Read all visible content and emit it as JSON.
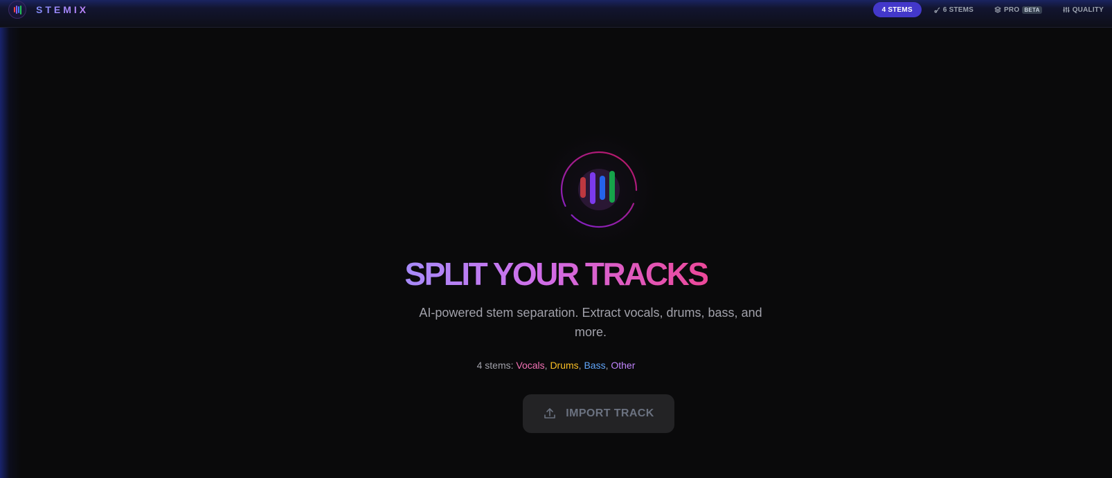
{
  "app": {
    "name": "STEMIX"
  },
  "nav": {
    "items": [
      {
        "label": "4 STEMS",
        "icon": "none",
        "active": true
      },
      {
        "label": "6 STEMS",
        "icon": "guitar-icon",
        "active": false
      },
      {
        "label": "PRO",
        "icon": "layers-icon",
        "badge": "BETA",
        "active": false
      },
      {
        "label": "QUALITY",
        "icon": "sliders-icon",
        "active": false
      }
    ]
  },
  "hero": {
    "icon": "waveform-icon",
    "title": "SPLIT YOUR TRACKS",
    "subtitle": "AI-powered stem separation. Extract vocals, drums, bass, and more.",
    "stems_prefix": "4 stems: ",
    "stems": [
      {
        "name": "Vocals",
        "color": "#f472b6"
      },
      {
        "name": "Drums",
        "color": "#fbbf24"
      },
      {
        "name": "Bass",
        "color": "#60a5fa"
      },
      {
        "name": "Other",
        "color": "#c084fc"
      }
    ],
    "separator": ", "
  },
  "import_button": {
    "label": "IMPORT TRACK",
    "icon": "upload-icon"
  },
  "colors": {
    "background": "#0a0a0b",
    "accent": "#4338ca",
    "title_gradient_start": "#a78bfa",
    "title_gradient_end": "#ec4899",
    "ring": "#a21caf"
  }
}
